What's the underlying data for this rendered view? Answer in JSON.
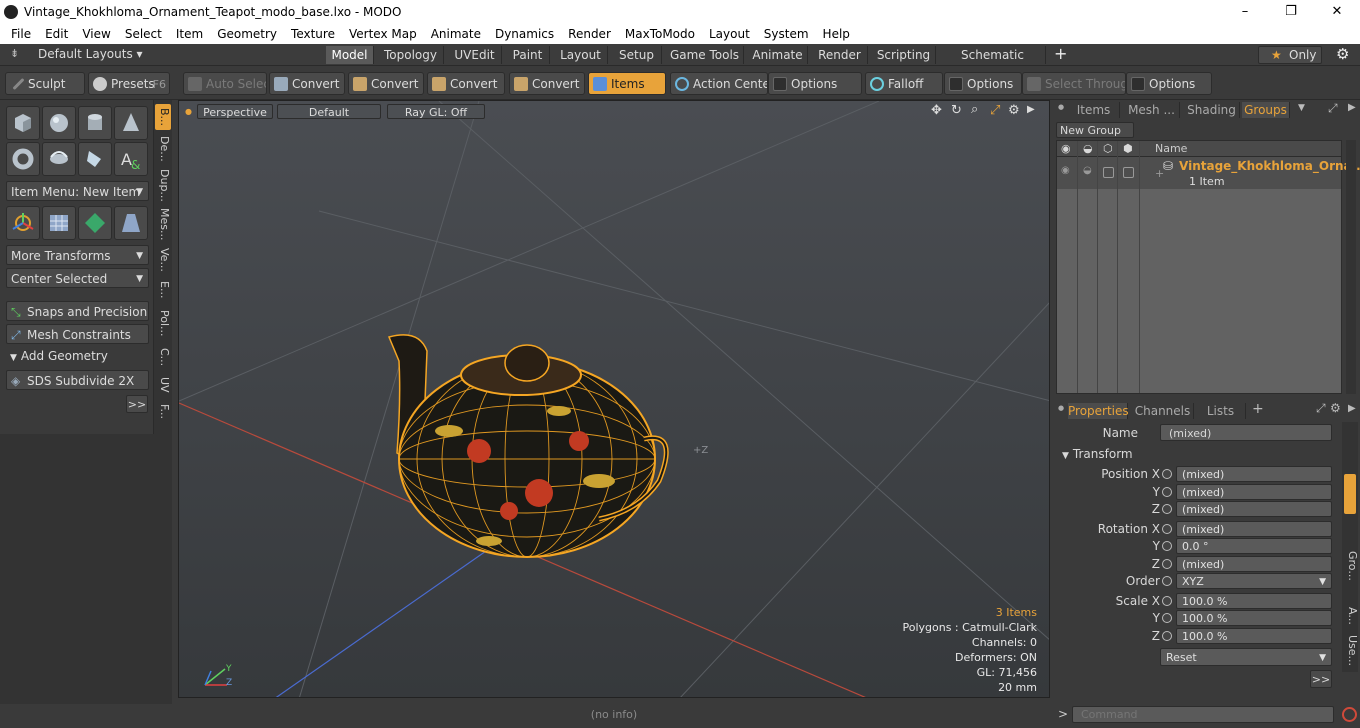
{
  "window": {
    "title": "Vintage_Khokhloma_Ornament_Teapot_modo_base.lxo - MODO",
    "min_icon": "–",
    "max_icon": "❐",
    "close_icon": "✕"
  },
  "menu": [
    "File",
    "Edit",
    "View",
    "Select",
    "Item",
    "Geometry",
    "Texture",
    "Vertex Map",
    "Animate",
    "Dynamics",
    "Render",
    "MaxToModo",
    "Layout",
    "System",
    "Help"
  ],
  "layoutbar": {
    "layouts_label": "Default Layouts ▾",
    "tabs": [
      "Model",
      "Topology",
      "UVEdit",
      "Paint",
      "Layout",
      "Setup",
      "Game Tools",
      "Animate",
      "Render",
      "Scripting",
      "Schematic Fusion"
    ],
    "active_tab": "Model",
    "add": "+",
    "only": "Only",
    "only_star": "★"
  },
  "toolbar": {
    "sculpt": "Sculpt",
    "presets": "Presets",
    "presets_key": "F6",
    "auto_select": "Auto Select",
    "convert1": "Convert",
    "convert2": "Convert",
    "convert3": "Convert",
    "convert4": "Convert",
    "items": "Items",
    "action_center": "Action Center",
    "options1": "Options",
    "falloff": "Falloff",
    "options2": "Options",
    "select_through": "Select Through",
    "options3": "Options"
  },
  "leftpanel": {
    "item_menu": "Item Menu: New Item",
    "more_transforms": "More Transforms",
    "center_selected": "Center Selected",
    "snaps": "Snaps and Precision",
    "mesh_constraints": "Mesh Constraints",
    "add_geometry": "Add Geometry",
    "sds": "SDS Subdivide 2X",
    "more": ">>",
    "vtabs": [
      "B...",
      "De...",
      "Dup...",
      "Mes...",
      "Ve...",
      "E...",
      "Pol...",
      "C...",
      "UV",
      "F..."
    ]
  },
  "viewport": {
    "perspective": "Perspective",
    "default": "Default",
    "raygl": "Ray GL: Off",
    "items_count": "3 Items",
    "polygons": "Polygons : Catmull-Clark",
    "channels": "Channels: 0",
    "deformers": "Deformers: ON",
    "gl": "GL: 71,456",
    "scale": "20 mm",
    "z_marker": "+Z",
    "axis_y": "Y",
    "axis_z": "Z"
  },
  "status": "(no info)",
  "itemlist": {
    "tabs": [
      "Items",
      "Mesh ...",
      "Shading",
      "Groups"
    ],
    "active_tab": "Groups",
    "new_group": "New Group",
    "col_name": "Name",
    "group_name": "Vintage_Khokhloma_Orna...",
    "group_sub": "1 Item"
  },
  "properties": {
    "tabs": [
      "Properties",
      "Channels",
      "Lists"
    ],
    "active_tab": "Properties",
    "add": "+",
    "name_label": "Name",
    "name_value": "(mixed)",
    "transform": "Transform",
    "pos_x_label": "Position X",
    "pos_x": "(mixed)",
    "pos_y_label": "Y",
    "pos_y": "(mixed)",
    "pos_z_label": "Z",
    "pos_z": "(mixed)",
    "rot_x_label": "Rotation X",
    "rot_x": "(mixed)",
    "rot_y_label": "Y",
    "rot_y": "0.0 °",
    "rot_z_label": "Z",
    "rot_z": "(mixed)",
    "order_label": "Order",
    "order": "XYZ",
    "scale_x_label": "Scale X",
    "scale_x": "100.0 %",
    "scale_y_label": "Y",
    "scale_y": "100.0 %",
    "scale_z_label": "Z",
    "scale_z": "100.0 %",
    "reset": "Reset",
    "more": ">>",
    "side_tabs": [
      "Gro...",
      "A...",
      "Use..."
    ]
  },
  "command": {
    "placeholder": "Command",
    "prompt": ">"
  },
  "colors": {
    "accent": "#e8a33a",
    "wire": "#f5a623"
  }
}
